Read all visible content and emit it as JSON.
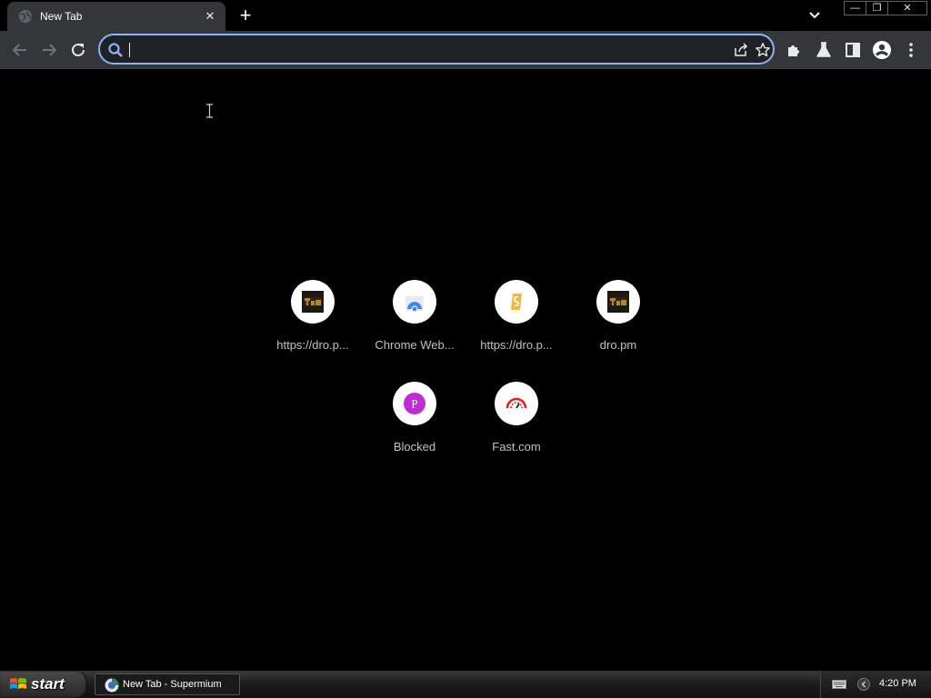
{
  "browser": {
    "tab": {
      "title": "New Tab",
      "close_glyph": "✕"
    },
    "new_tab_glyph": "+",
    "window_controls": {
      "minimize": "—",
      "restore": "❐",
      "close": "✕"
    }
  },
  "toolbar": {
    "omnibox": {
      "value": "",
      "placeholder": ""
    },
    "icons": [
      "back-icon",
      "forward-icon",
      "reload-icon",
      "search-icon",
      "share-icon",
      "star-icon",
      "extensions-icon",
      "labs-icon",
      "side-panel-icon",
      "profile-icon",
      "menu-icon"
    ]
  },
  "shortcuts": [
    {
      "label": "https://dro.p...",
      "icon": "dro-logo-icon"
    },
    {
      "label": "Chrome Web...",
      "icon": "chrome-web-store-icon"
    },
    {
      "label": "https://dro.p...",
      "icon": "s-logo-icon"
    },
    {
      "label": "dro.pm",
      "icon": "dro-logo-icon"
    },
    {
      "label": "Blocked",
      "icon": "p-letter-icon",
      "letter": "P"
    },
    {
      "label": "Fast.com",
      "icon": "speedometer-icon"
    }
  ],
  "taskbar": {
    "start_label": "start",
    "task_label": "New Tab - Supermium",
    "clock": "4:20 PM"
  },
  "colors": {
    "tab_bg": "#35363a",
    "toolbar_bg": "#35363a",
    "omnibox_focus": "#8ab4f8",
    "page_bg": "#000000",
    "blocked_purple": "#c12bd6",
    "fast_red": "#e22020"
  }
}
